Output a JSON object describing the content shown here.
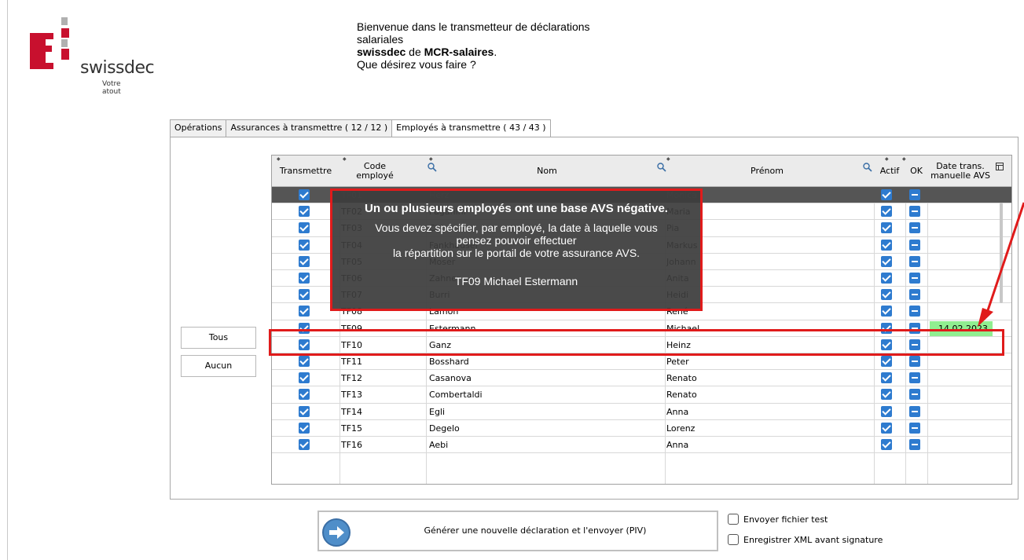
{
  "logo": {
    "word": "swissdec",
    "tagline": "Votre atout"
  },
  "welcome": {
    "line1": "Bienvenue dans le transmetteur de déclarations",
    "line2": "salariales",
    "brand": "swissdec",
    "de": " de ",
    "product": "MCR-salaires",
    "dot": ".",
    "question": "Que désirez vous faire ?"
  },
  "tabs": [
    {
      "label": "Opérations"
    },
    {
      "label": "Assurances à transmettre ( 12 / 12 )"
    },
    {
      "label": "Employés à transmettre ( 43 / 43 )"
    }
  ],
  "side_buttons": {
    "all": "Tous",
    "none": "Aucun"
  },
  "table": {
    "headers": {
      "transmit": "Transmettre",
      "code_line1": "Code",
      "code_line2": "employé",
      "name": "Nom",
      "firstname": "Prénom",
      "active": "Actif",
      "ok": "OK",
      "date_line1": "Date trans.",
      "date_line2": "manuelle AVS"
    },
    "rows": [
      {
        "code": "TF01",
        "name": "Herz",
        "firstname": "Monica",
        "date": ""
      },
      {
        "code": "TF02",
        "name": "Paganini",
        "firstname": "Maria",
        "date": ""
      },
      {
        "code": "TF03",
        "name": "Chi",
        "firstname": "Pia",
        "date": ""
      },
      {
        "code": "TF04",
        "name": "Fankhauser",
        "firstname": "Markus",
        "date": ""
      },
      {
        "code": "TF05",
        "name": "Moser",
        "firstname": "Johann",
        "date": ""
      },
      {
        "code": "TF06",
        "name": "Zahner",
        "firstname": "Anita",
        "date": ""
      },
      {
        "code": "TF07",
        "name": "Burri",
        "firstname": "Heidi",
        "date": ""
      },
      {
        "code": "TF08",
        "name": "Lamon",
        "firstname": "René",
        "date": ""
      },
      {
        "code": "TF09",
        "name": "Estermann",
        "firstname": "Michael",
        "date": "14.02.2023"
      },
      {
        "code": "TF10",
        "name": "Ganz",
        "firstname": "Heinz",
        "date": ""
      },
      {
        "code": "TF11",
        "name": "Bosshard",
        "firstname": "Peter",
        "date": ""
      },
      {
        "code": "TF12",
        "name": "Casanova",
        "firstname": "Renato",
        "date": ""
      },
      {
        "code": "TF13",
        "name": "Combertaldi",
        "firstname": "Renato",
        "date": ""
      },
      {
        "code": "TF14",
        "name": "Egli",
        "firstname": "Anna",
        "date": ""
      },
      {
        "code": "TF15",
        "name": "Degelo",
        "firstname": "Lorenz",
        "date": ""
      },
      {
        "code": "TF16",
        "name": "Aebi",
        "firstname": "Anna",
        "date": ""
      }
    ]
  },
  "overlay": {
    "title": "Un ou plusieurs employés ont une base AVS négative.",
    "line1": "Vous devez spécifier, par employé, la date à laquelle vous",
    "line2": "pensez pouvoir effectuer",
    "line3": "la répartition sur le portail de votre assurance AVS.",
    "employee": "TF09 Michael Estermann"
  },
  "bottom": {
    "generate": "Générer une nouvelle déclaration et l'envoyer (PIV)",
    "test_file": "Envoyer fichier test",
    "save_xml": "Enregistrer XML avant signature"
  },
  "colors": {
    "accent_red": "#e01b1b",
    "check_blue": "#2e7bcf",
    "date_green": "#90ee90"
  }
}
